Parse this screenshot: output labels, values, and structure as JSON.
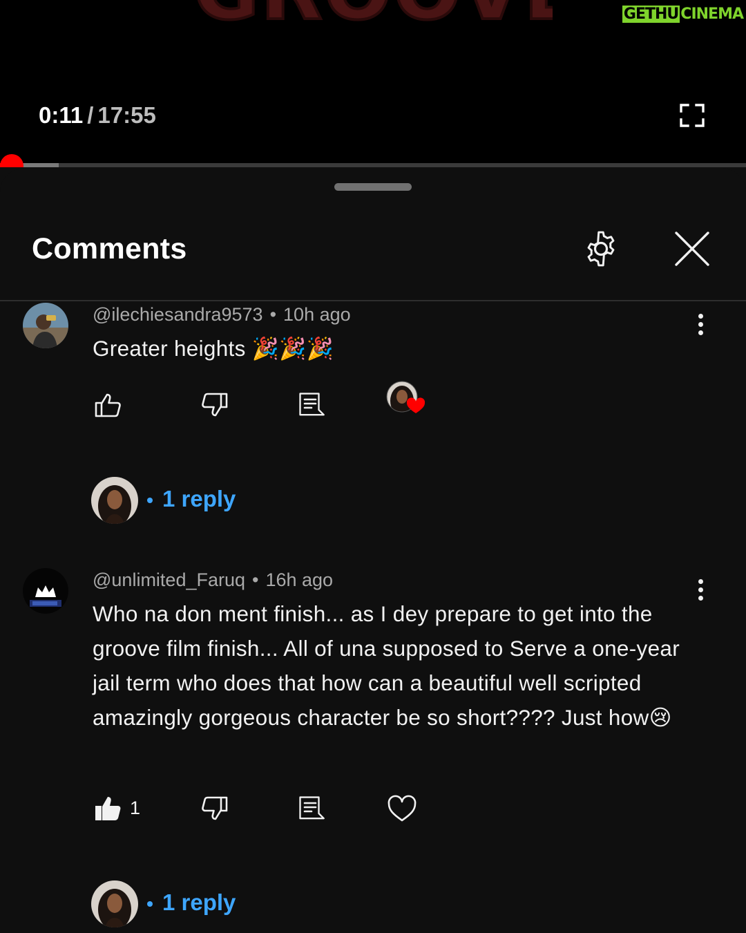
{
  "player": {
    "title_art_text": "GROOVE",
    "watermark": {
      "part1": "GETHU",
      "part2": "CINEMA"
    },
    "current_time": "0:11",
    "separator": "/",
    "duration": "17:55",
    "progress_fraction": 0.0102,
    "buffered_fraction": 0.079,
    "icons": {
      "fullscreen": "fullscreen-icon"
    }
  },
  "comments_panel": {
    "title": "Comments",
    "icons": {
      "settings": "gear-icon",
      "close": "close-icon"
    },
    "items": [
      {
        "author": "@ilechiesandra9573",
        "age": "10h ago",
        "text": "Greater heights 🎉🎉🎉",
        "like_count": "",
        "liked": false,
        "creator_heart": true,
        "reply_label": "1 reply"
      },
      {
        "author": "@unlimited_Faruq",
        "age": "16h ago",
        "text": "Who na don ment finish... as I dey prepare to get into the groove film finish... All of una supposed to Serve a one-year jail term who does that how can a beautiful well scripted amazingly gorgeous character be so short???? Just how😢",
        "like_count": "1",
        "liked": true,
        "creator_heart": false,
        "reply_label": "1 reply"
      }
    ]
  },
  "colors": {
    "accent": "#ff0000",
    "link": "#3ea6ff",
    "background": "#0f0f0f",
    "watermark": "#7fd32c"
  }
}
